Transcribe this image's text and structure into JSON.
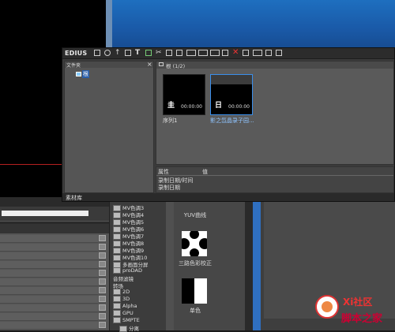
{
  "app": {
    "name": "EDIUS"
  },
  "folder_panel": {
    "title": "文件夹",
    "close": "×",
    "root_label": "根"
  },
  "bin": {
    "title": "根 (1/2)"
  },
  "clips": [
    {
      "label": "序列1",
      "icon": "圭",
      "tc": "00:00:00"
    },
    {
      "label": "影之氙晶录子园...",
      "icon": "日",
      "tc": "00:00:00"
    }
  ],
  "properties": {
    "col_property": "属性",
    "col_value": "值",
    "rows": [
      "录制日期/时间",
      "录制日期"
    ]
  },
  "status": {
    "tab": "素材库"
  },
  "effects_list": [
    "MV色调3",
    "MV色调4",
    "MV色调5",
    "MV色调6",
    "MV色调7",
    "MV色调8",
    "MV色调9",
    "MV色调10",
    "多画面分屏",
    "proDAD",
    "音频滤镜",
    "转场",
    "2D",
    "3D",
    "Alpha",
    "GPU",
    "SMPTE",
    "分离"
  ],
  "effects_grid": [
    {
      "label": "YUV曲线"
    },
    {
      "label": "三路色彩校正"
    },
    {
      "label": "单色"
    }
  ],
  "watermark": {
    "line1": "Xi社区",
    "line2": "脚本之家"
  },
  "colors": {
    "accent_blue": "#2f6fc0",
    "timeline_red": "#b52020",
    "selected_border": "#3a8eea"
  }
}
